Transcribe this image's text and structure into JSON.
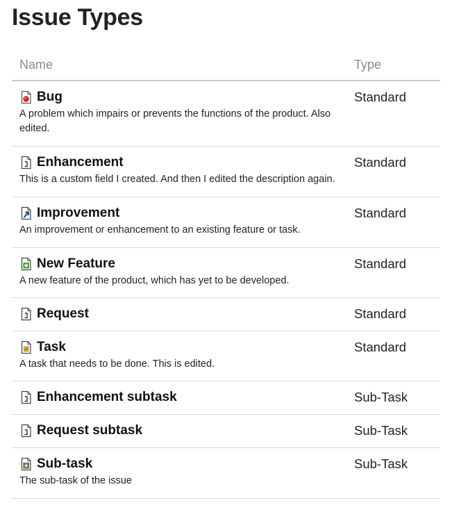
{
  "page": {
    "title": "Issue Types"
  },
  "table": {
    "columns": {
      "name": "Name",
      "type": "Type"
    },
    "rows": [
      {
        "name": "Bug",
        "icon": "bug-icon",
        "description": "A problem which impairs or prevents the functions of the product. Also edited.",
        "type": "Standard"
      },
      {
        "name": "Enhancement",
        "icon": "generic-issue-icon",
        "description": "This is a custom field I created. And then I edited the description again.",
        "type": "Standard"
      },
      {
        "name": "Improvement",
        "icon": "improvement-icon",
        "description": "An improvement or enhancement to an existing feature or task.",
        "type": "Standard"
      },
      {
        "name": "New Feature",
        "icon": "new-feature-icon",
        "description": "A new feature of the product, which has yet to be developed.",
        "type": "Standard"
      },
      {
        "name": "Request",
        "icon": "generic-issue-icon",
        "description": "",
        "type": "Standard"
      },
      {
        "name": "Task",
        "icon": "task-icon",
        "description": "A task that needs to be done. This is edited.",
        "type": "Standard"
      },
      {
        "name": "Enhancement subtask",
        "icon": "generic-issue-icon",
        "description": "",
        "type": "Sub-Task"
      },
      {
        "name": "Request subtask",
        "icon": "generic-issue-icon",
        "description": "",
        "type": "Sub-Task"
      },
      {
        "name": "Sub-task",
        "icon": "subtask-icon",
        "description": "The sub-task of the issue",
        "type": "Sub-Task"
      }
    ]
  }
}
